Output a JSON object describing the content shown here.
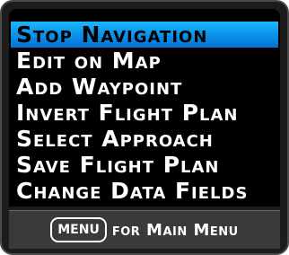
{
  "menu": {
    "items": [
      {
        "label": "Stop Navigation",
        "selected": true
      },
      {
        "label": "Edit on Map",
        "selected": false
      },
      {
        "label": "Add Waypoint",
        "selected": false
      },
      {
        "label": "Invert Flight Plan",
        "selected": false
      },
      {
        "label": "Select Approach",
        "selected": false
      },
      {
        "label": "Save Flight Plan",
        "selected": false
      },
      {
        "label": "Change Data Fields",
        "selected": false
      }
    ]
  },
  "footer": {
    "key_label": "MENU",
    "hint_text": "for Main Menu"
  },
  "colors": {
    "highlight": "#1ba3f2",
    "screen_background": "#000000",
    "footer_background": "#3a3a3a",
    "text": "#ffffff"
  }
}
